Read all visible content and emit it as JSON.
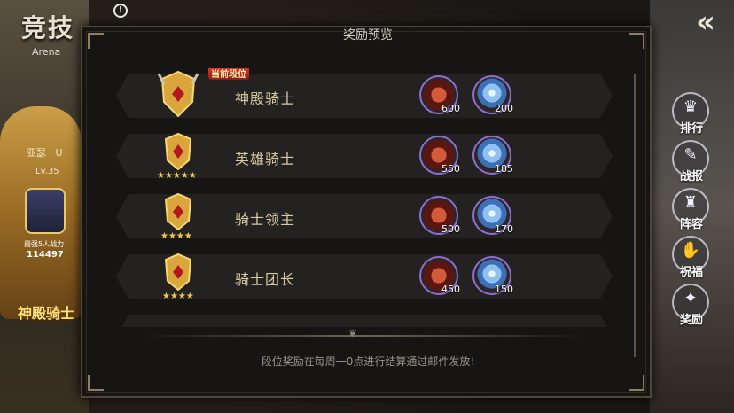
{
  "header": {
    "title": "竞技",
    "subtitle": "Arena",
    "info_icon": "info-icon",
    "back_icon": "double-chevron-left-icon"
  },
  "player_card": {
    "name": "亚瑟 · U",
    "level": "Lv.35",
    "power_label": "最强5人战力",
    "power": "114497",
    "rank": "神殿骑士"
  },
  "side_menu": [
    {
      "label": "排行",
      "icon": "ranking-icon"
    },
    {
      "label": "战报",
      "icon": "battle-report-icon"
    },
    {
      "label": "阵容",
      "icon": "lineup-icon"
    },
    {
      "label": "祝福",
      "icon": "blessing-icon"
    },
    {
      "label": "奖励",
      "icon": "reward-icon"
    }
  ],
  "modal": {
    "title": "奖励预览",
    "current_tag": "当前段位",
    "footer": "段位奖励在每周一0点进行结算通过邮件发放!",
    "tiers": [
      {
        "name": "神殿骑士",
        "current": true,
        "gold": "600",
        "gem": "200"
      },
      {
        "name": "英雄骑士",
        "current": false,
        "gold": "550",
        "gem": "185"
      },
      {
        "name": "骑士领主",
        "current": false,
        "gold": "500",
        "gem": "170"
      },
      {
        "name": "骑士团长",
        "current": false,
        "gold": "450",
        "gem": "150"
      }
    ]
  },
  "colors": {
    "tier_name": "#d8c9a2",
    "reward_ring": "#8e6fd0",
    "current_tag_bg": "#e13a2d"
  }
}
